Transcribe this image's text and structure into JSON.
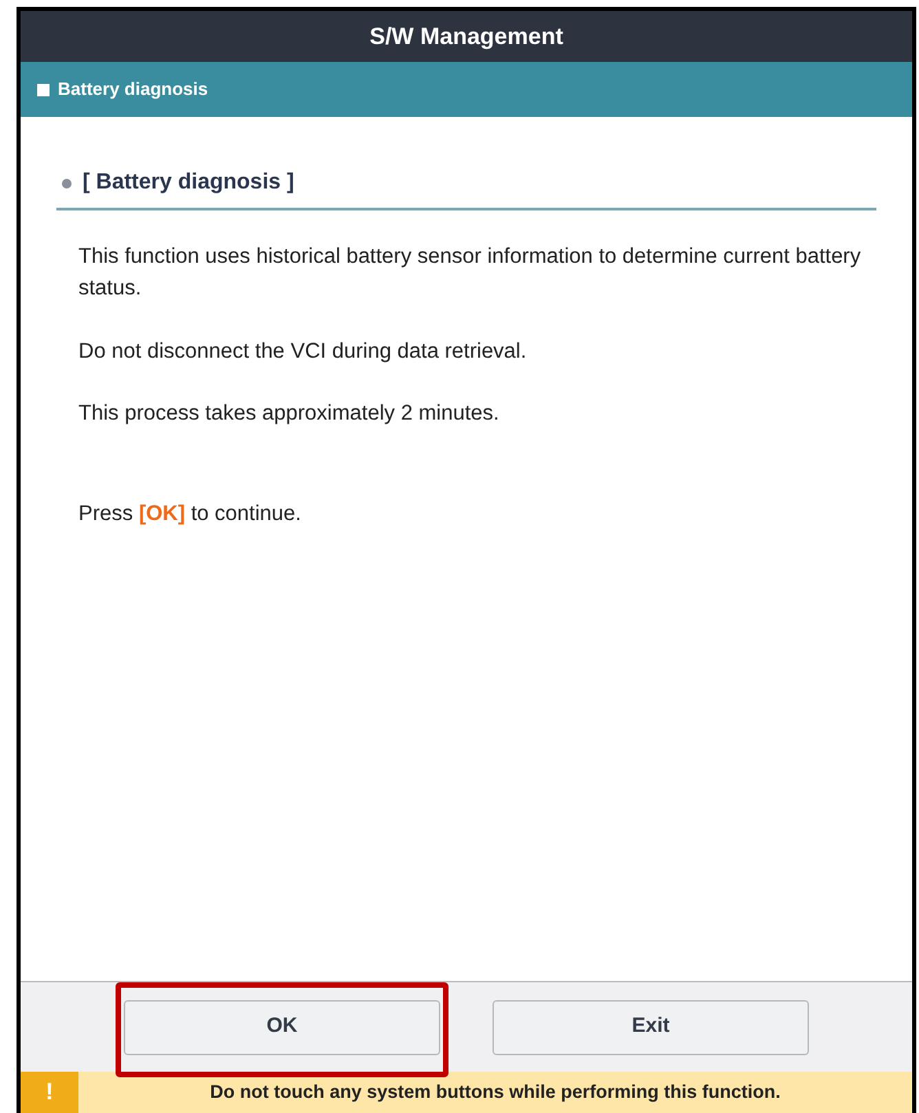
{
  "window": {
    "title": "S/W Management"
  },
  "section_bar": {
    "title": "Battery diagnosis"
  },
  "content": {
    "heading": "[ Battery diagnosis ]",
    "paragraphs": [
      "This function uses historical battery sensor information to determine current battery status.",
      "Do not disconnect the VCI during data retrieval.",
      "This process takes approximately 2 minutes.",
      "Press **[OK]** to continue."
    ]
  },
  "buttons": [
    {
      "label": "OK",
      "highlighted": true
    },
    {
      "label": "Exit",
      "highlighted": false
    }
  ],
  "warning": {
    "icon": "!",
    "text": "Do not touch any system buttons while performing this function."
  }
}
